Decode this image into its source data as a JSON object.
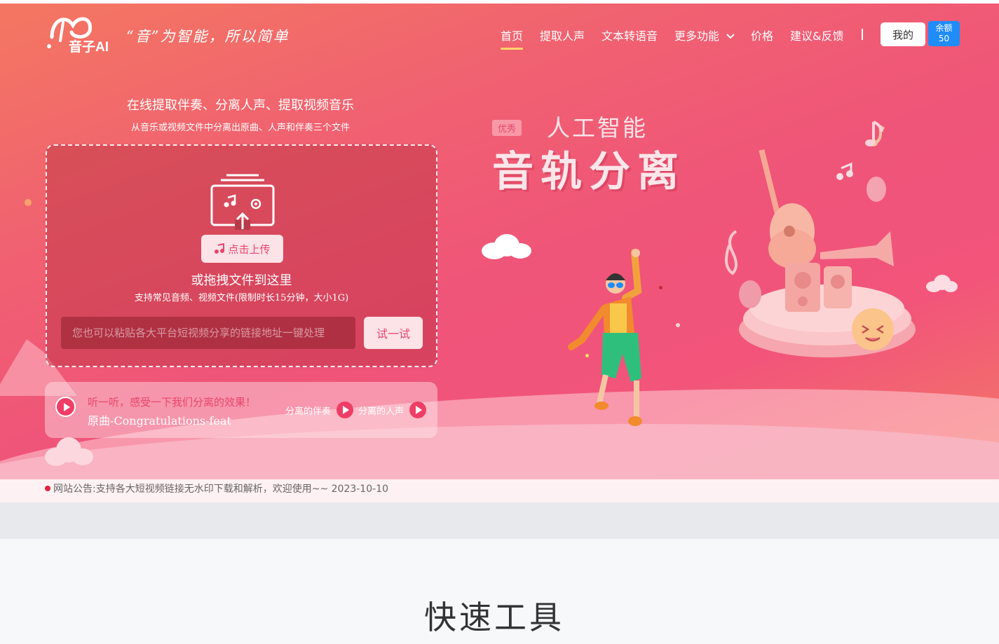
{
  "colors": {
    "hero_start": "#f47761",
    "hero_mid": "#ef5479",
    "accent_pink": "#ef3e66",
    "nav_underline": "#ffd36a",
    "balance_blue": "#1f8cf7"
  },
  "header": {
    "logo_text": "音子AI",
    "slogan": "“音”为智能，所以简单",
    "nav": [
      "首页",
      "提取人声",
      "文本转语音",
      "更多功能",
      "价格",
      "建议&反馈"
    ],
    "active_nav": "首页",
    "more_icon": "chevron-down-icon",
    "mine_label": "我的",
    "balance_label": "余额",
    "balance_value": "50"
  },
  "upload": {
    "title": "在线提取伴奏、分离人声、提取视频音乐",
    "subtitle": "从音乐或视频文件中分离出原曲、人声和伴奏三个文件",
    "icon": "upload-file-icon",
    "upload_button": "点击上传",
    "drag_text": "或拖拽文件到这里",
    "support_text": "支持常见音频、视频文件(限制时长15分钟，大小1G)",
    "link_placeholder": "您也可以粘贴各大平台短视频分享的链接地址一键处理",
    "try_button": "试一试"
  },
  "demo": {
    "prompt": "听一听，感受一下我们分离的效果！",
    "track_name": "原曲-Congratulations-feat",
    "accompaniment_label": "分离的伴奏",
    "vocal_label": "分离的人声"
  },
  "banner": {
    "badge": "优秀",
    "line1": "人工智能",
    "line2": "音轨分离"
  },
  "notice": {
    "text": "网站公告:支持各大短视频链接无水印下载和解析，欢迎使用~~ 2023-10-10"
  },
  "tools": {
    "title": "快速工具"
  }
}
